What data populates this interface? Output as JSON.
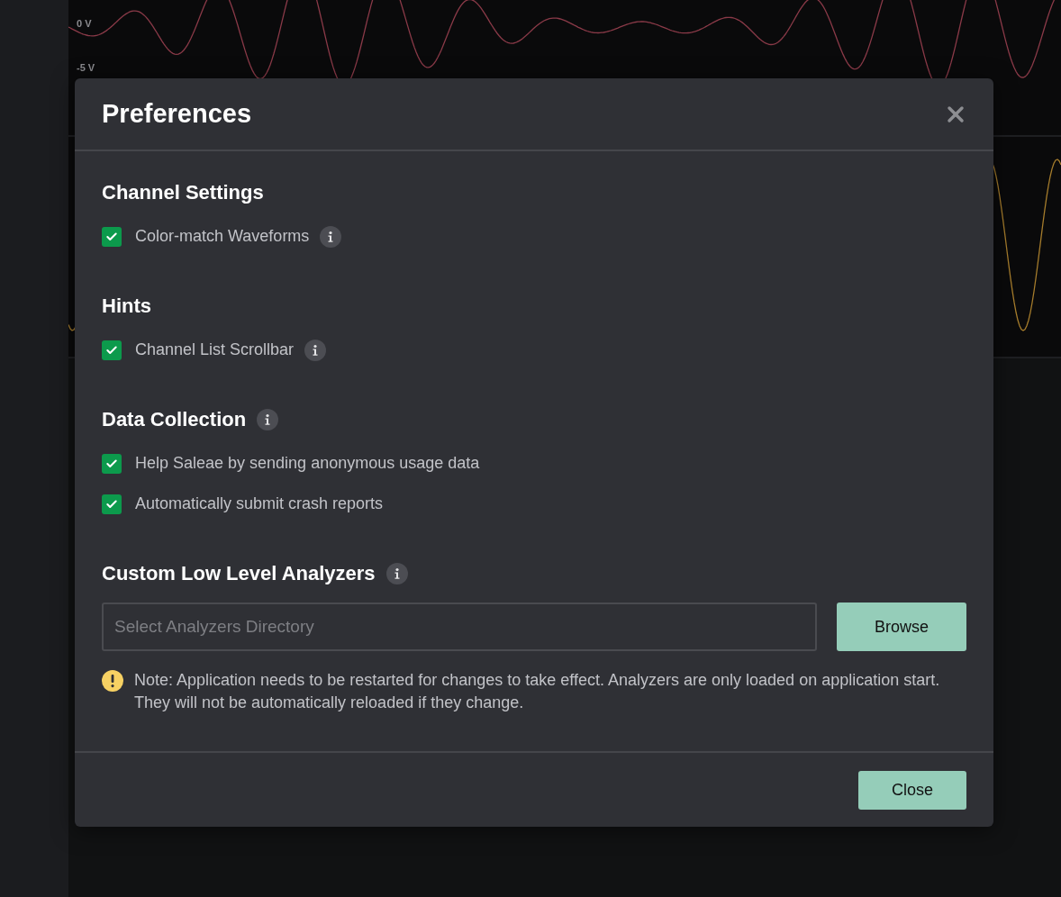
{
  "background": {
    "channels": [
      {
        "kind": "analog",
        "color": "#8a3a48",
        "axis_labels": [
          "0 V",
          "-5 V"
        ]
      },
      {
        "kind": "analog",
        "color": "#a57c2c"
      }
    ]
  },
  "dialog": {
    "title": "Preferences",
    "sections": [
      {
        "kind": "checkboxes",
        "title": "Channel Settings",
        "info": false,
        "items": [
          {
            "label": "Color-match Waveforms",
            "checked": true,
            "info": true
          }
        ]
      },
      {
        "kind": "checkboxes",
        "title": "Hints",
        "info": false,
        "items": [
          {
            "label": "Channel List Scrollbar",
            "checked": true,
            "info": true
          }
        ]
      },
      {
        "kind": "checkboxes",
        "title": "Data Collection",
        "info": true,
        "items": [
          {
            "label": "Help Saleae by sending anonymous usage data",
            "checked": true,
            "info": false
          },
          {
            "label": "Automatically submit crash reports",
            "checked": true,
            "info": false
          }
        ]
      },
      {
        "kind": "directory",
        "title": "Custom Low Level Analyzers",
        "info": true,
        "placeholder": "Select Analyzers Directory",
        "button": "Browse",
        "note": "Note: Application needs to be restarted for changes to take effect. Analyzers are only loaded on application start. They will not be automatically reloaded if they change."
      }
    ],
    "footer_button": "Close"
  }
}
